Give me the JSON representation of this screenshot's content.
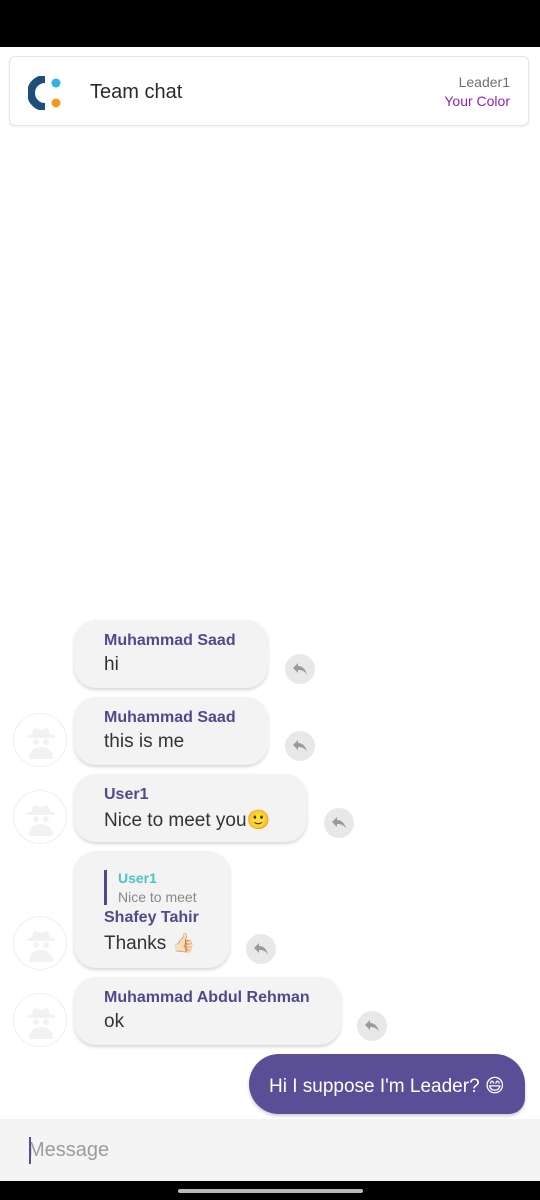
{
  "header": {
    "title": "Team chat",
    "role": "Leader1",
    "color_label": "Your Color"
  },
  "messages": [
    {
      "sender": "Muhammad Saad",
      "text": "hi",
      "avatar": false
    },
    {
      "sender": "Muhammad Saad",
      "text": "this is me",
      "avatar": true
    },
    {
      "sender": "User1",
      "text": "Nice to meet you🙂",
      "avatar": true
    },
    {
      "sender": "Shafey Tahir",
      "text": "Thanks 👍🏻",
      "avatar": true,
      "quote": {
        "sender": "User1",
        "text": "Nice to meet"
      }
    },
    {
      "sender": "Muhammad Abdul Rehman",
      "text": "ok",
      "avatar": true
    }
  ],
  "my_message": {
    "text": "Hi I suppose I'm Leader? 😄"
  },
  "composer": {
    "placeholder": "Message"
  },
  "colors": {
    "accent": "#5a4f96",
    "sender_name": "#4f4a8c",
    "quote_sender": "#4ec3c3",
    "your_color": "#8e24aa",
    "logo_dark": "#1d4f7a",
    "logo_blue": "#2fb4e6",
    "logo_orange": "#f39a1e"
  },
  "icons": {
    "logo": "app-logo-icon",
    "avatar": "anonymous-spy-avatar-icon",
    "reply": "reply-arrow-icon"
  }
}
